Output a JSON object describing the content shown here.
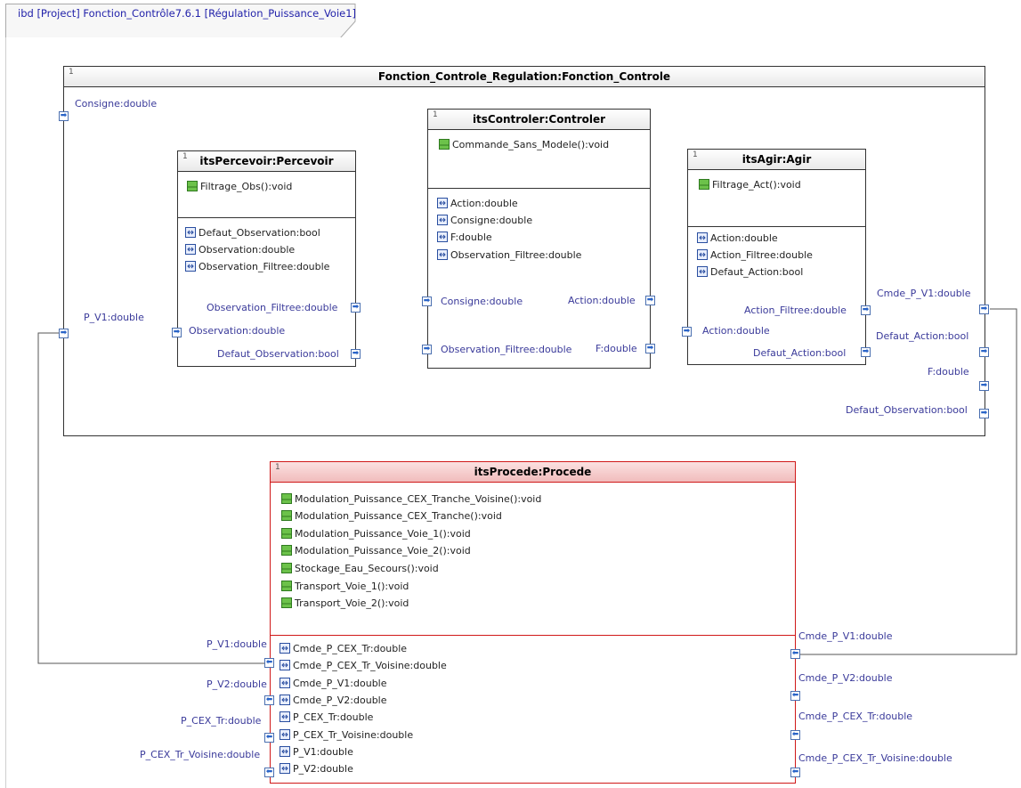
{
  "frame": {
    "title": "ibd [Project] Fonction_Contrôle7.6.1 [Régulation_Puissance_Voie1]"
  },
  "outer": {
    "num": "1",
    "title": "Fonction_Controle_Regulation:Fonction_Controle",
    "ports": {
      "consigne": "Consigne:double",
      "p_v1": "P_V1:double",
      "cmde_p_v1": "Cmde_P_V1:double",
      "defaut_action": "Defaut_Action:bool",
      "f": "F:double",
      "defaut_observation": "Defaut_Observation:bool"
    }
  },
  "percevoir": {
    "num": "1",
    "title": "itsPercevoir:Percevoir",
    "operations": [
      "Filtrage_Obs():void"
    ],
    "attributes": [
      "Defaut_Observation:bool",
      "Observation:double",
      "Observation_Filtree:double"
    ],
    "ports": {
      "observation_filtree": "Observation_Filtree:double",
      "observation": "Observation:double",
      "defaut_observation": "Defaut_Observation:bool"
    }
  },
  "controler": {
    "num": "1",
    "title": "itsControler:Controler",
    "operations": [
      "Commande_Sans_Modele():void"
    ],
    "attributes": [
      "Action:double",
      "Consigne:double",
      "F:double",
      "Observation_Filtree:double"
    ],
    "ports": {
      "consigne": "Consigne:double",
      "action": "Action:double",
      "observation_filtree": "Observation_Filtree:double",
      "f": "F:double"
    }
  },
  "agir": {
    "num": "1",
    "title": "itsAgir:Agir",
    "operations": [
      "Filtrage_Act():void"
    ],
    "attributes": [
      "Action:double",
      "Action_Filtree:double",
      "Defaut_Action:bool"
    ],
    "ports": {
      "action_filtree": "Action_Filtree:double",
      "action": "Action:double",
      "defaut_action": "Defaut_Action:bool"
    }
  },
  "procede": {
    "num": "1",
    "title": "itsProcede:Procede",
    "operations": [
      "Modulation_Puissance_CEX_Tranche_Voisine():void",
      "Modulation_Puissance_CEX_Tranche():void",
      "Modulation_Puissance_Voie_1():void",
      "Modulation_Puissance_Voie_2():void",
      "Stockage_Eau_Secours():void",
      "Transport_Voie_1():void",
      "Transport_Voie_2():void"
    ],
    "attributes": [
      "Cmde_P_CEX_Tr:double",
      "Cmde_P_CEX_Tr_Voisine:double",
      "Cmde_P_V1:double",
      "Cmde_P_V2:double",
      "P_CEX_Tr:double",
      "P_CEX_Tr_Voisine:double",
      "P_V1:double",
      "P_V2:double"
    ],
    "left_ports": [
      "P_V1:double",
      "P_V2:double",
      "P_CEX_Tr:double",
      "P_CEX_Tr_Voisine:double"
    ],
    "right_ports": [
      "Cmde_P_V1:double",
      "Cmde_P_V2:double",
      "Cmde_P_CEX_Tr:double",
      "Cmde_P_CEX_Tr_Voisine:double"
    ]
  },
  "colors": {
    "line": "#555555",
    "port_border": "#4a6fb0",
    "label": "#3a3a9a",
    "procede_border": "#d01818"
  },
  "icons": {
    "operation": "operation-icon",
    "attribute": "attribute-icon",
    "port_out": "arrow-right-port",
    "port_in": "arrow-left-port"
  }
}
